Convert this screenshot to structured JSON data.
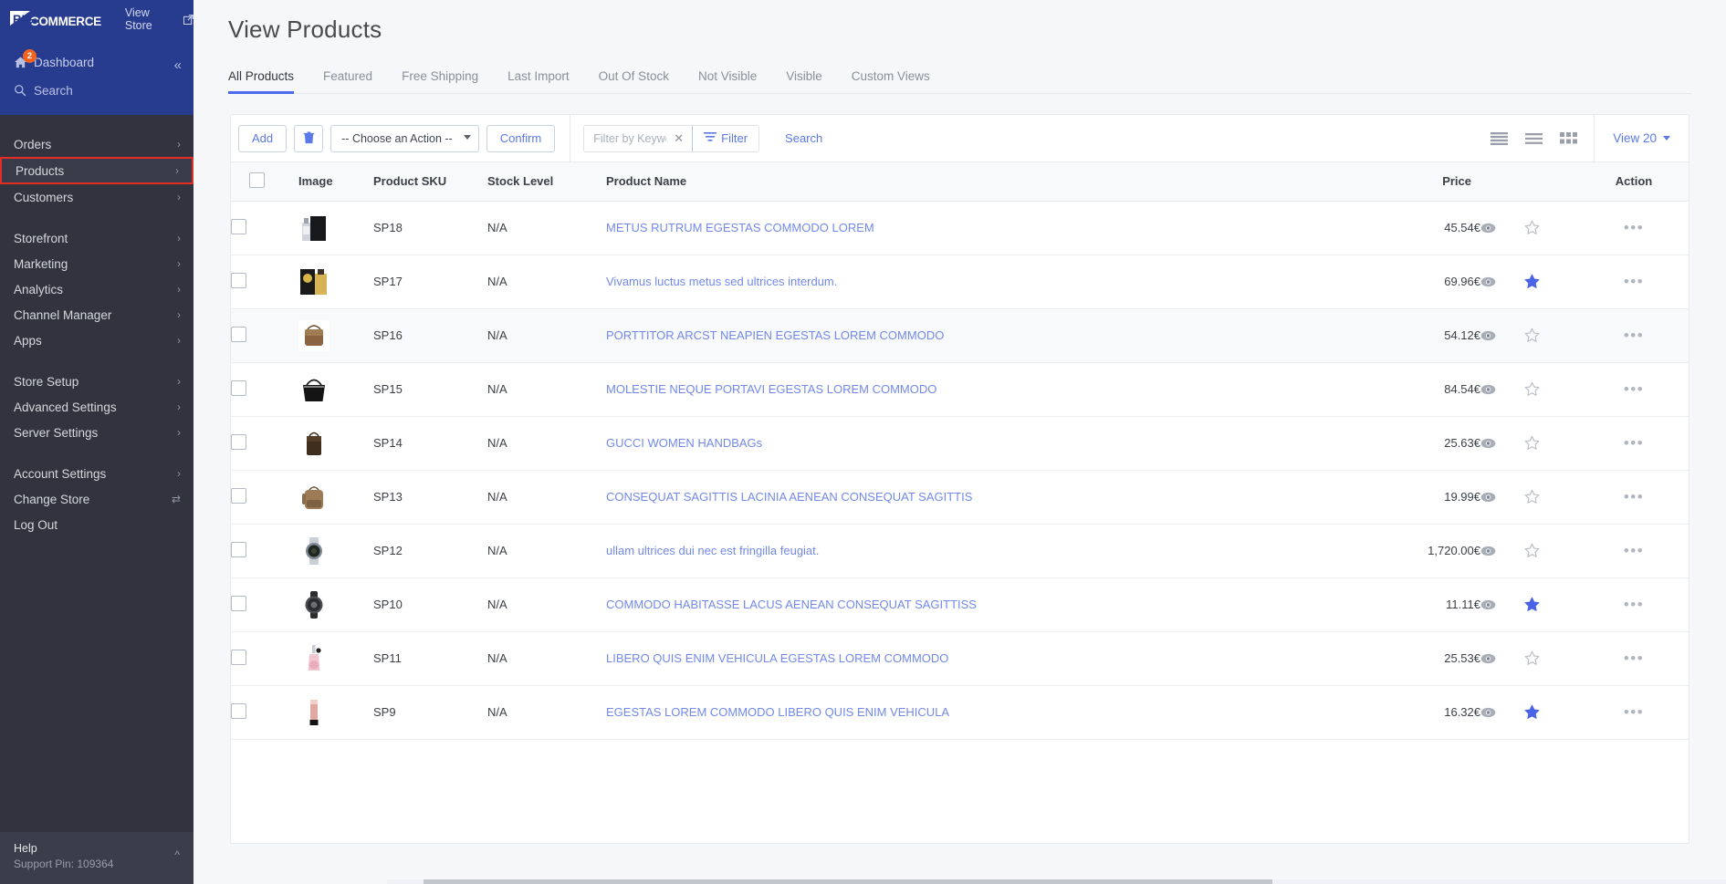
{
  "brand": {
    "logo_big": "BIG",
    "logo_commerce": "COMMERCE",
    "view_store": "View Store",
    "view_store_icon": "external-link-icon"
  },
  "sidebar": {
    "dashboard": {
      "label": "Dashboard",
      "badge": "2",
      "icon": "home-icon"
    },
    "search": {
      "label": "Search",
      "icon": "search-icon"
    },
    "collapse_icon": "chevron-double-left-icon",
    "groups": [
      {
        "items": [
          {
            "label": "Orders",
            "chevron": "›",
            "highlighted": false
          },
          {
            "label": "Products",
            "chevron": "›",
            "highlighted": true
          },
          {
            "label": "Customers",
            "chevron": "›",
            "highlighted": false
          }
        ]
      },
      {
        "items": [
          {
            "label": "Storefront",
            "chevron": "›",
            "highlighted": false
          },
          {
            "label": "Marketing",
            "chevron": "›",
            "highlighted": false
          },
          {
            "label": "Analytics",
            "chevron": "›",
            "highlighted": false
          },
          {
            "label": "Channel Manager",
            "chevron": "›",
            "highlighted": false
          },
          {
            "label": "Apps",
            "chevron": "›",
            "highlighted": false
          }
        ]
      },
      {
        "items": [
          {
            "label": "Store Setup",
            "chevron": "›",
            "highlighted": false
          },
          {
            "label": "Advanced Settings",
            "chevron": "›",
            "highlighted": false
          },
          {
            "label": "Server Settings",
            "chevron": "›",
            "highlighted": false
          }
        ]
      },
      {
        "items": [
          {
            "label": "Account Settings",
            "chevron": "›",
            "highlighted": false
          },
          {
            "label": "Change Store",
            "chevron": "⇄",
            "highlighted": false
          },
          {
            "label": "Log Out",
            "chevron": "",
            "highlighted": false
          }
        ]
      }
    ],
    "help": {
      "title": "Help",
      "support_pin": "Support Pin: 109364",
      "caret_icon": "chevron-up-icon"
    }
  },
  "header": {
    "title": "View Products"
  },
  "tabs": [
    {
      "label": "All Products",
      "active": true
    },
    {
      "label": "Featured",
      "active": false
    },
    {
      "label": "Free Shipping",
      "active": false
    },
    {
      "label": "Last Import",
      "active": false
    },
    {
      "label": "Out Of Stock",
      "active": false
    },
    {
      "label": "Not Visible",
      "active": false
    },
    {
      "label": "Visible",
      "active": false
    },
    {
      "label": "Custom Views",
      "active": false
    }
  ],
  "toolbar": {
    "add_label": "Add",
    "delete_icon": "trash-icon",
    "action_select": "-- Choose an Action --",
    "confirm_label": "Confirm",
    "filter_placeholder": "Filter by Keyword",
    "filter_value": "",
    "clear_icon": "close-x-icon",
    "filter_label": "Filter",
    "filter_icon": "filter-icon",
    "search_label": "Search",
    "view_icons": [
      "list-dense-icon",
      "list-icon",
      "grid-icon"
    ],
    "view_count_label": "View 20"
  },
  "table": {
    "columns": [
      "",
      "Image",
      "Product SKU",
      "Stock Level",
      "Product Name",
      "Price",
      "",
      "",
      "Action"
    ],
    "action_icons": {
      "preview": "eye-icon",
      "featured": "star-icon",
      "more": "ellipsis-icon"
    },
    "rows": [
      {
        "sku": "SP18",
        "stock": "N/A",
        "name": "METUS RUTRUM EGESTAS COMMODO LOREM",
        "price": "45.54€",
        "featured": false,
        "thumb": "perfume-black-box"
      },
      {
        "sku": "SP17",
        "stock": "N/A",
        "name": "Vivamus luctus metus sed ultrices interdum.",
        "price": "69.96€",
        "featured": true,
        "thumb": "perfume-gold-box"
      },
      {
        "sku": "SP16",
        "stock": "N/A",
        "name": "PORTTITOR ARCST NEAPIEN EGESTAS LOREM COMMODO",
        "price": "54.12€",
        "featured": false,
        "thumb": "handbag-brown-monogram"
      },
      {
        "sku": "SP15",
        "stock": "N/A",
        "name": "MOLESTIE NEQUE PORTAVI EGESTAS LOREM COMMODO",
        "price": "84.54€",
        "featured": false,
        "thumb": "handbag-black-tote"
      },
      {
        "sku": "SP14",
        "stock": "N/A",
        "name": "GUCCI WOMEN HANDBAGs",
        "price": "25.63€",
        "featured": false,
        "thumb": "handbag-dark-brown"
      },
      {
        "sku": "SP13",
        "stock": "N/A",
        "name": "CONSEQUAT SAGITTIS LACINIA AENEAN CONSEQUAT SAGITTIS",
        "price": "19.99€",
        "featured": false,
        "thumb": "backpack-tan"
      },
      {
        "sku": "SP12",
        "stock": "N/A",
        "name": "ullam ultrices dui nec est fringilla feugiat.",
        "price": "1,720.00€",
        "featured": false,
        "thumb": "watch-steel"
      },
      {
        "sku": "SP10",
        "stock": "N/A",
        "name": "COMMODO HABITASSE LACUS AENEAN CONSEQUAT SAGITTISS",
        "price": "11.11€",
        "featured": true,
        "thumb": "watch-dark"
      },
      {
        "sku": "SP11",
        "stock": "N/A",
        "name": "LIBERO QUIS ENIM VEHICULA EGESTAS LOREM COMMODO",
        "price": "25.53€",
        "featured": false,
        "thumb": "perfume-pink-bottle"
      },
      {
        "sku": "SP9",
        "stock": "N/A",
        "name": "EGESTAS LOREM COMMODO LIBERO QUIS ENIM VEHICULA",
        "price": "16.32€",
        "featured": true,
        "thumb": "cosmetic-tube-pink"
      }
    ]
  },
  "colors": {
    "brand_blue": "#273b8f",
    "sidebar_dark": "#32333f",
    "accent": "#5b7ae8",
    "link": "#7289ea",
    "highlight_border": "#e52d27",
    "badge_orange": "#f26322",
    "star_active": "#4a63e7"
  }
}
